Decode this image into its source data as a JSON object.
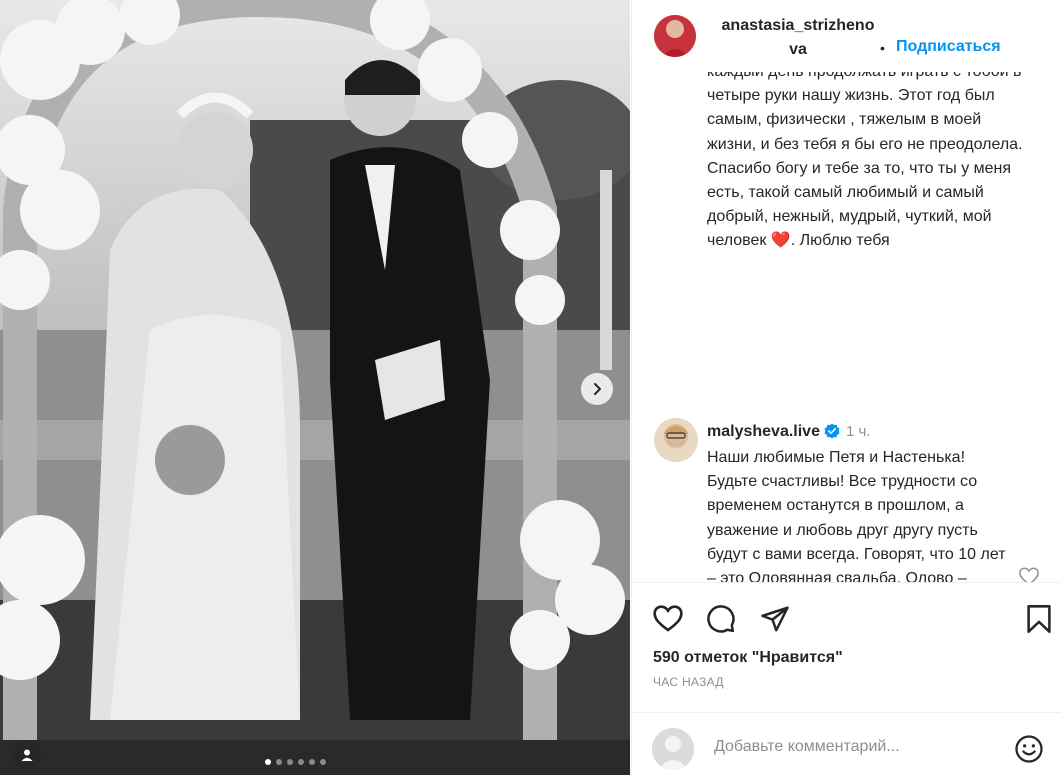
{
  "post": {
    "author": "anastasia_strizhenova",
    "follow_label": "Подписаться",
    "header_separator": "•",
    "caption": "каждый день продолжать играть с тобой в четыре руки нашу жизнь. Этот год был самым, физически , тяжелым в моей жизни, и без тебя я бы его не преодолела. Спасибо богу и тебе за то, что ты у меня есть, такой самый любимый и самый добрый, нежный, мудрый, чуткий, мой человек ❤️. Люблю тебя",
    "carousel": {
      "total_slides": 6,
      "current_slide": 1
    }
  },
  "comment": {
    "username": "malysheva.live",
    "verified": true,
    "time": "1 ч.",
    "text": "Наши любимые Петя и Настенька! Будьте счастливы! Все трудности со временем останутся в прошлом, а уважение и любовь друг другу пусть будут с вами всегда. Говорят, что 10 лет – это Оловянная свадьба. Олово – крепкий металл и, в тоже время, прочный и нежный. Любим вас и"
  },
  "actions": {
    "icons": [
      "heart-icon",
      "comment-icon",
      "share-icon",
      "bookmark-icon"
    ]
  },
  "likes": "590 отметок \"Нравится\"",
  "time_ago": "ЧАС НАЗАД",
  "comment_input": {
    "placeholder": "Добавьте комментарий..."
  },
  "colors": {
    "accent": "#0095f6",
    "text": "#262626",
    "muted": "#8e8e8e",
    "verified": "#0095f6"
  }
}
